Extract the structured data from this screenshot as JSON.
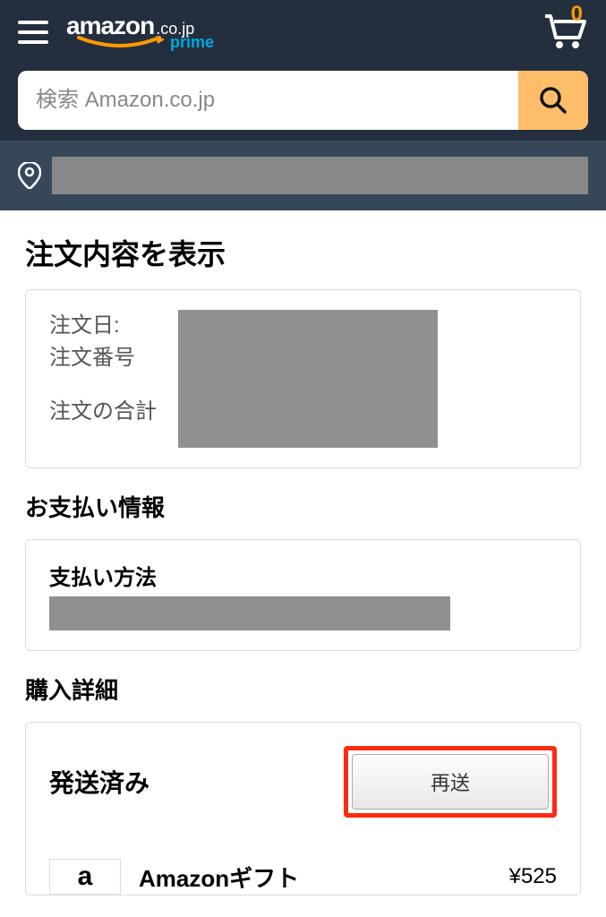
{
  "header": {
    "logo_text": "amazon",
    "locale": ".co.jp",
    "prime": "prime",
    "cart_count": "0"
  },
  "search": {
    "placeholder": "検索 Amazon.co.jp"
  },
  "page": {
    "title": "注文内容を表示"
  },
  "order_info": {
    "date_label": "注文日:",
    "number_label": "注文番号",
    "total_label": "注文の合計"
  },
  "payment": {
    "section_title": "お支払い情報",
    "method_label": "支払い方法"
  },
  "purchase": {
    "section_title": "購入詳細",
    "shipped_label": "発送済み",
    "resend_label": "再送",
    "product_name": "Amazonギフト",
    "product_price": "¥525",
    "thumb_char": "a"
  }
}
